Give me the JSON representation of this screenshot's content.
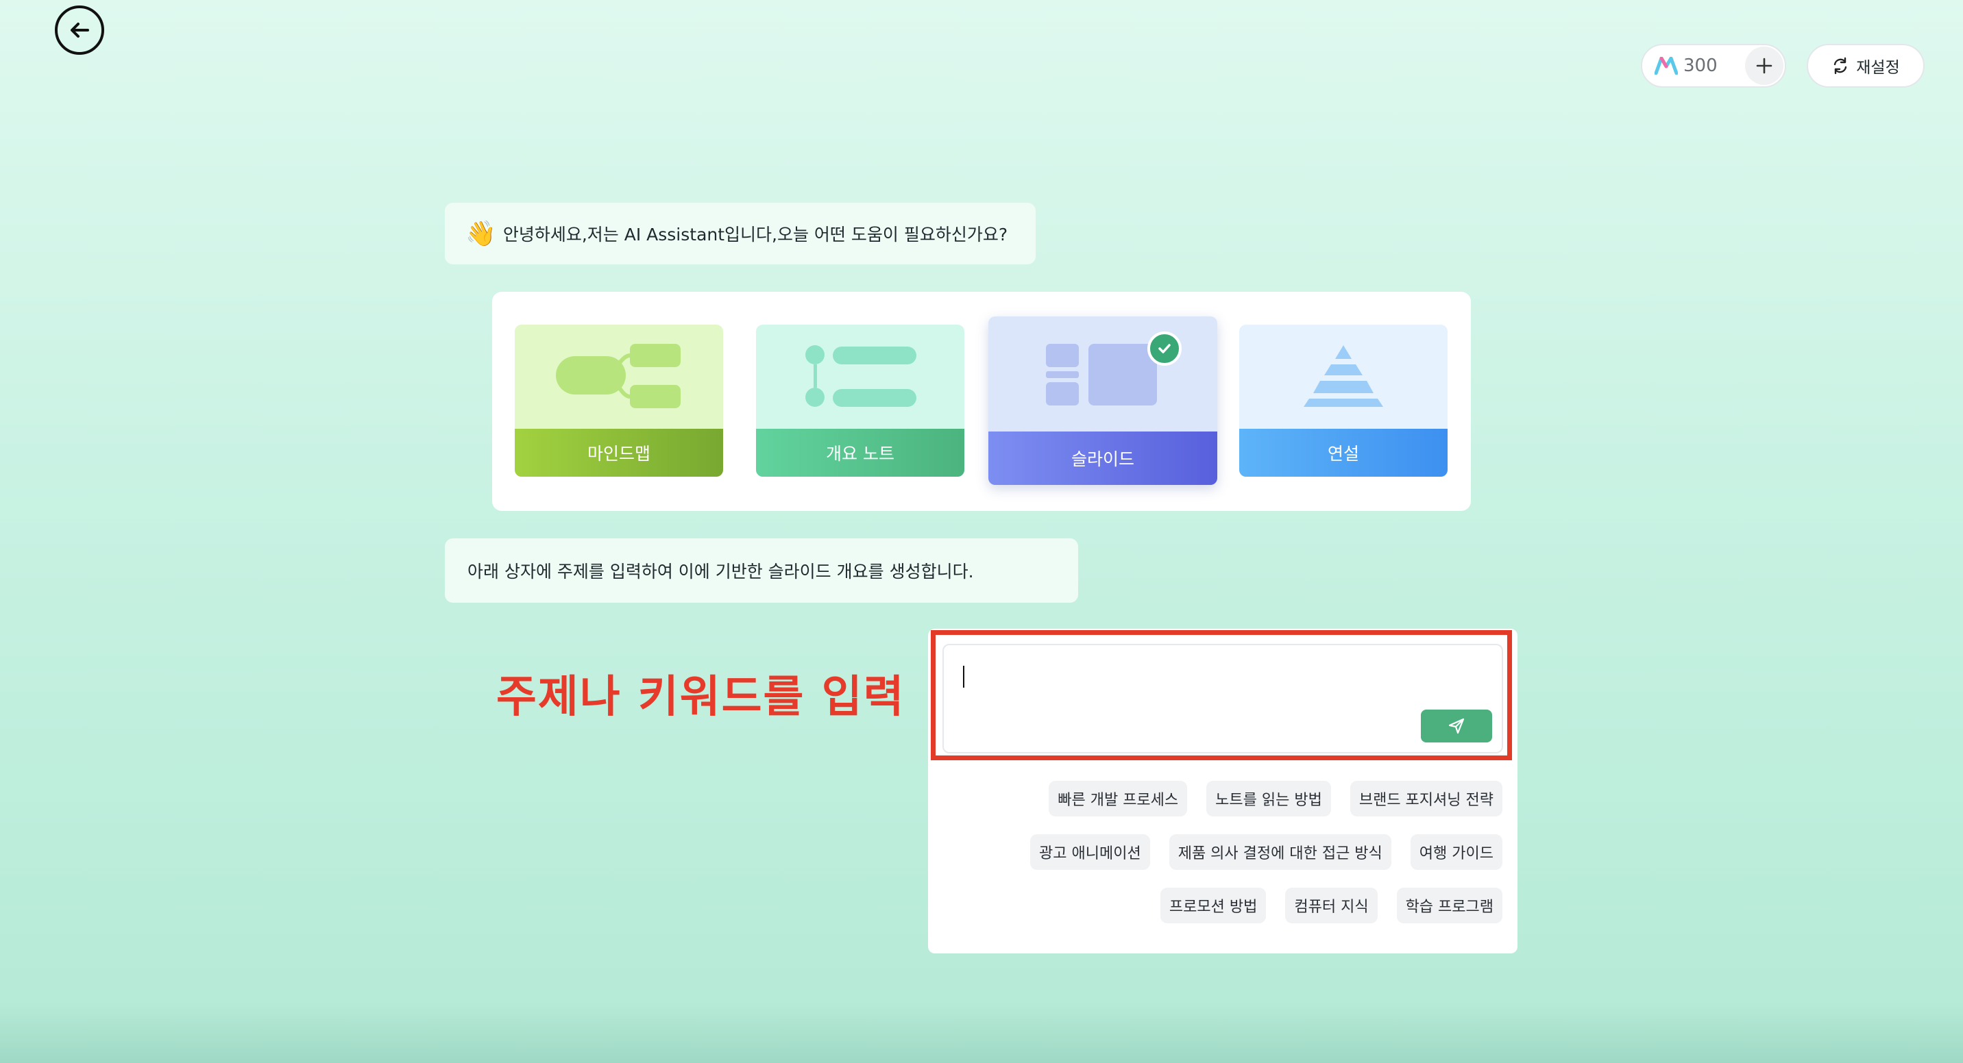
{
  "header": {
    "credits": "300",
    "reset_label": "재설정"
  },
  "chat": {
    "greeting_emoji": "👋",
    "greeting": "안녕하세요,저는 AI Assistant입니다,오늘 어떤 도움이 필요하신가요?",
    "hint": "아래 상자에 주제를 입력하여 이에 기반한 슬라이드 개요를 생성합니다."
  },
  "modes": [
    {
      "label": "마인드맵",
      "icon": "mindmap-icon",
      "selected": false
    },
    {
      "label": "개요 노트",
      "icon": "outline-list-icon",
      "selected": false
    },
    {
      "label": "슬라이드",
      "icon": "slides-layout-icon",
      "selected": true
    },
    {
      "label": "연설",
      "icon": "pyramid-icon",
      "selected": false
    }
  ],
  "annotation": "주제나 키워드를 입력",
  "input": {
    "value": "",
    "placeholder": ""
  },
  "suggestions": [
    [
      "빠른 개발 프로세스",
      "노트를 읽는 방법",
      "브랜드 포지셔닝 전략"
    ],
    [
      "광고 애니메이션",
      "제품 의사 결정에 대한 접근 방식",
      "여행 가이드"
    ],
    [
      "프로모션 방법",
      "컴퓨터 지식",
      "학습 프로그램"
    ]
  ],
  "colors": {
    "accent_green": "#4cb07e",
    "annotation_red": "#e63a2a",
    "selected_check": "#3aa876"
  }
}
